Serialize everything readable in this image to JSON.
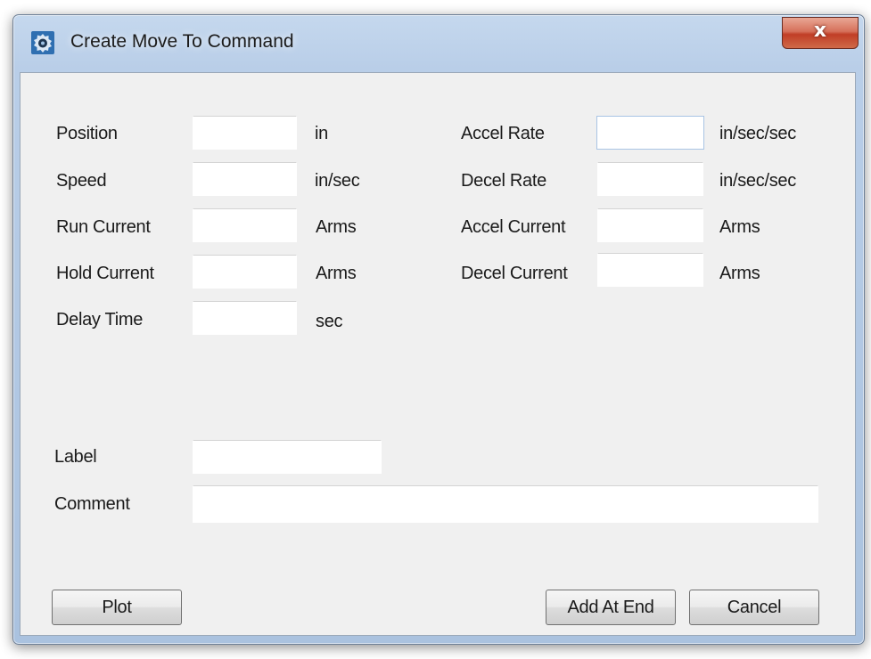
{
  "window": {
    "title": "Create Move To Command",
    "close_glyph": "x",
    "app_icon": "motor-gear-icon"
  },
  "form": {
    "left_fields": [
      {
        "label": "Position",
        "value": "",
        "unit": "in"
      },
      {
        "label": "Speed",
        "value": "",
        "unit": "in/sec"
      },
      {
        "label": "Run Current",
        "value": "",
        "unit": "Arms"
      },
      {
        "label": "Hold Current",
        "value": "",
        "unit": "Arms"
      },
      {
        "label": "Delay Time",
        "value": "",
        "unit": "sec"
      }
    ],
    "right_fields": [
      {
        "label": "Accel Rate",
        "value": "",
        "unit": "in/sec/sec"
      },
      {
        "label": "Decel Rate",
        "value": "",
        "unit": "in/sec/sec"
      },
      {
        "label": "Accel Current",
        "value": "",
        "unit": "Arms"
      },
      {
        "label": "Decel Current",
        "value": "",
        "unit": "Arms"
      }
    ],
    "label_field": {
      "label": "Label",
      "value": ""
    },
    "comment_field": {
      "label": "Comment",
      "value": ""
    }
  },
  "buttons": {
    "plot": "Plot",
    "add_at_end": "Add At End",
    "cancel": "Cancel"
  },
  "colors": {
    "title_bar": "#b9cee8",
    "client_bg": "#f0f0f0",
    "close_button": "#c94a32",
    "active_field_border": "#a9c4e4"
  }
}
